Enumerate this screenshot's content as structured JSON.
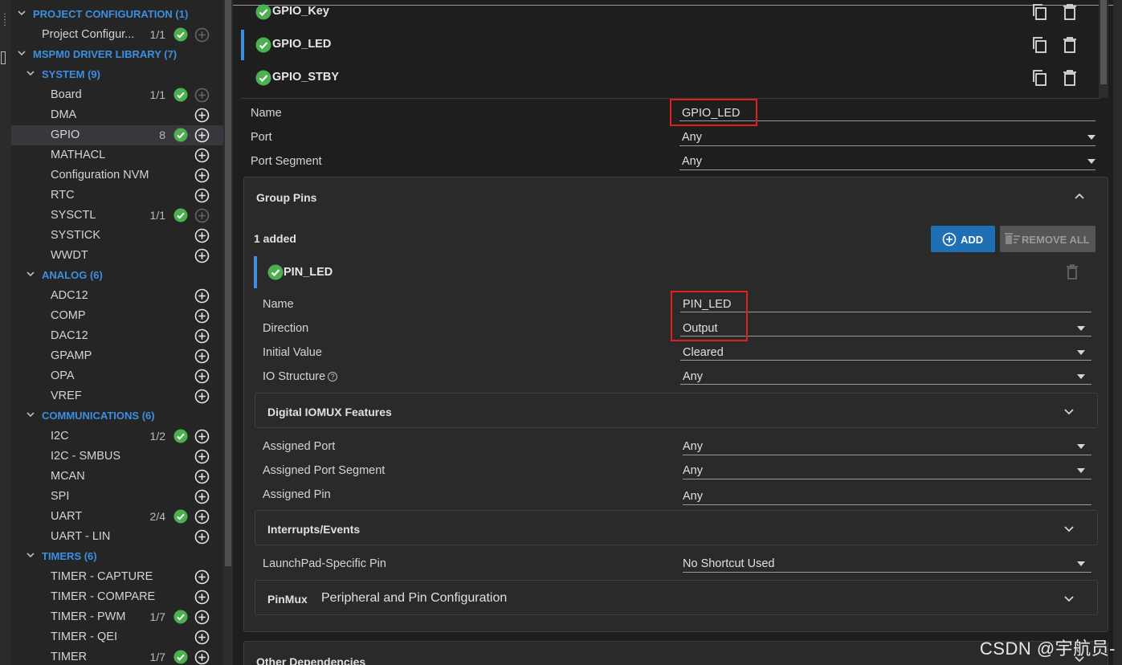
{
  "colors": {
    "accent": "#3c8fe0",
    "success": "#4caf50",
    "highlight_box": "#e0201c",
    "add_button": "#1f6fb5"
  },
  "sidebar": {
    "rows": [
      {
        "type": "category",
        "label": "PROJECT CONFIGURATION (1)",
        "level": 0
      },
      {
        "type": "item",
        "label": "Project Configur...",
        "count": "1/1",
        "check": true,
        "plus": "disabled"
      },
      {
        "type": "category",
        "label": "MSPM0 DRIVER LIBRARY (7)",
        "level": 0
      },
      {
        "type": "category",
        "label": "SYSTEM (9)",
        "level": 1
      },
      {
        "type": "item",
        "label": "Board",
        "count": "1/1",
        "check": true,
        "plus": "disabled"
      },
      {
        "type": "item",
        "label": "DMA",
        "count": "",
        "check": false,
        "plus": "enabled"
      },
      {
        "type": "item",
        "label": "GPIO",
        "count": "8",
        "check": true,
        "plus": "enabled",
        "selected": true
      },
      {
        "type": "item",
        "label": "MATHACL",
        "count": "",
        "check": false,
        "plus": "enabled"
      },
      {
        "type": "item",
        "label": "Configuration NVM",
        "count": "",
        "check": false,
        "plus": "enabled"
      },
      {
        "type": "item",
        "label": "RTC",
        "count": "",
        "check": false,
        "plus": "enabled"
      },
      {
        "type": "item",
        "label": "SYSCTL",
        "count": "1/1",
        "check": true,
        "plus": "disabled"
      },
      {
        "type": "item",
        "label": "SYSTICK",
        "count": "",
        "check": false,
        "plus": "enabled"
      },
      {
        "type": "item",
        "label": "WWDT",
        "count": "",
        "check": false,
        "plus": "enabled"
      },
      {
        "type": "category",
        "label": "ANALOG (6)",
        "level": 1
      },
      {
        "type": "item",
        "label": "ADC12",
        "count": "",
        "check": false,
        "plus": "enabled"
      },
      {
        "type": "item",
        "label": "COMP",
        "count": "",
        "check": false,
        "plus": "enabled"
      },
      {
        "type": "item",
        "label": "DAC12",
        "count": "",
        "check": false,
        "plus": "enabled"
      },
      {
        "type": "item",
        "label": "GPAMP",
        "count": "",
        "check": false,
        "plus": "enabled"
      },
      {
        "type": "item",
        "label": "OPA",
        "count": "",
        "check": false,
        "plus": "enabled"
      },
      {
        "type": "item",
        "label": "VREF",
        "count": "",
        "check": false,
        "plus": "enabled"
      },
      {
        "type": "category",
        "label": "COMMUNICATIONS (6)",
        "level": 1
      },
      {
        "type": "item",
        "label": "I2C",
        "count": "1/2",
        "check": true,
        "plus": "enabled"
      },
      {
        "type": "item",
        "label": "I2C - SMBUS",
        "count": "",
        "check": false,
        "plus": "enabled"
      },
      {
        "type": "item",
        "label": "MCAN",
        "count": "",
        "check": false,
        "plus": "enabled"
      },
      {
        "type": "item",
        "label": "SPI",
        "count": "",
        "check": false,
        "plus": "enabled"
      },
      {
        "type": "item",
        "label": "UART",
        "count": "2/4",
        "check": true,
        "plus": "enabled"
      },
      {
        "type": "item",
        "label": "UART - LIN",
        "count": "",
        "check": false,
        "plus": "enabled"
      },
      {
        "type": "category",
        "label": "TIMERS (6)",
        "level": 1
      },
      {
        "type": "item",
        "label": "TIMER - CAPTURE",
        "count": "",
        "check": false,
        "plus": "enabled"
      },
      {
        "type": "item",
        "label": "TIMER - COMPARE",
        "count": "",
        "check": false,
        "plus": "enabled"
      },
      {
        "type": "item",
        "label": "TIMER - PWM",
        "count": "1/7",
        "check": true,
        "plus": "enabled"
      },
      {
        "type": "item",
        "label": "TIMER - QEI",
        "count": "",
        "check": false,
        "plus": "enabled"
      },
      {
        "type": "item",
        "label": "TIMER",
        "count": "1/7",
        "check": true,
        "plus": "enabled"
      }
    ]
  },
  "instances": [
    {
      "label": "GPIO_Key",
      "active": false
    },
    {
      "label": "GPIO_LED",
      "active": true
    },
    {
      "label": "GPIO_STBY",
      "active": false
    }
  ],
  "gpio_props": {
    "name_label": "Name",
    "name_value": "GPIO_LED",
    "port_label": "Port",
    "port_value": "Any",
    "segment_label": "Port Segment",
    "segment_value": "Any"
  },
  "group_pins": {
    "title": "Group Pins",
    "added_text": "1 added",
    "add_label": "ADD",
    "remove_all_label": "REMOVE ALL",
    "pin_label": "PIN_LED",
    "props": {
      "name_label": "Name",
      "name_value": "PIN_LED",
      "direction_label": "Direction",
      "direction_value": "Output",
      "initial_label": "Initial Value",
      "initial_value": "Cleared",
      "io_label": "IO Structure",
      "io_help": "?",
      "io_value": "Any"
    },
    "digital_iomux_title": "Digital IOMUX Features",
    "assigned": {
      "port_label": "Assigned Port",
      "port_value": "Any",
      "segment_label": "Assigned Port Segment",
      "segment_value": "Any",
      "pin_label": "Assigned Pin",
      "pin_value": "Any"
    },
    "interrupts_title": "Interrupts/Events",
    "launchpad_label": "LaunchPad-Specific Pin",
    "launchpad_value": "No Shortcut Used",
    "pinmux_title": "PinMux",
    "pinmux_subtitle": "Peripheral and Pin Configuration"
  },
  "other_dependencies_title": "Other Dependencies",
  "watermark": "CSDN @宇航员-"
}
